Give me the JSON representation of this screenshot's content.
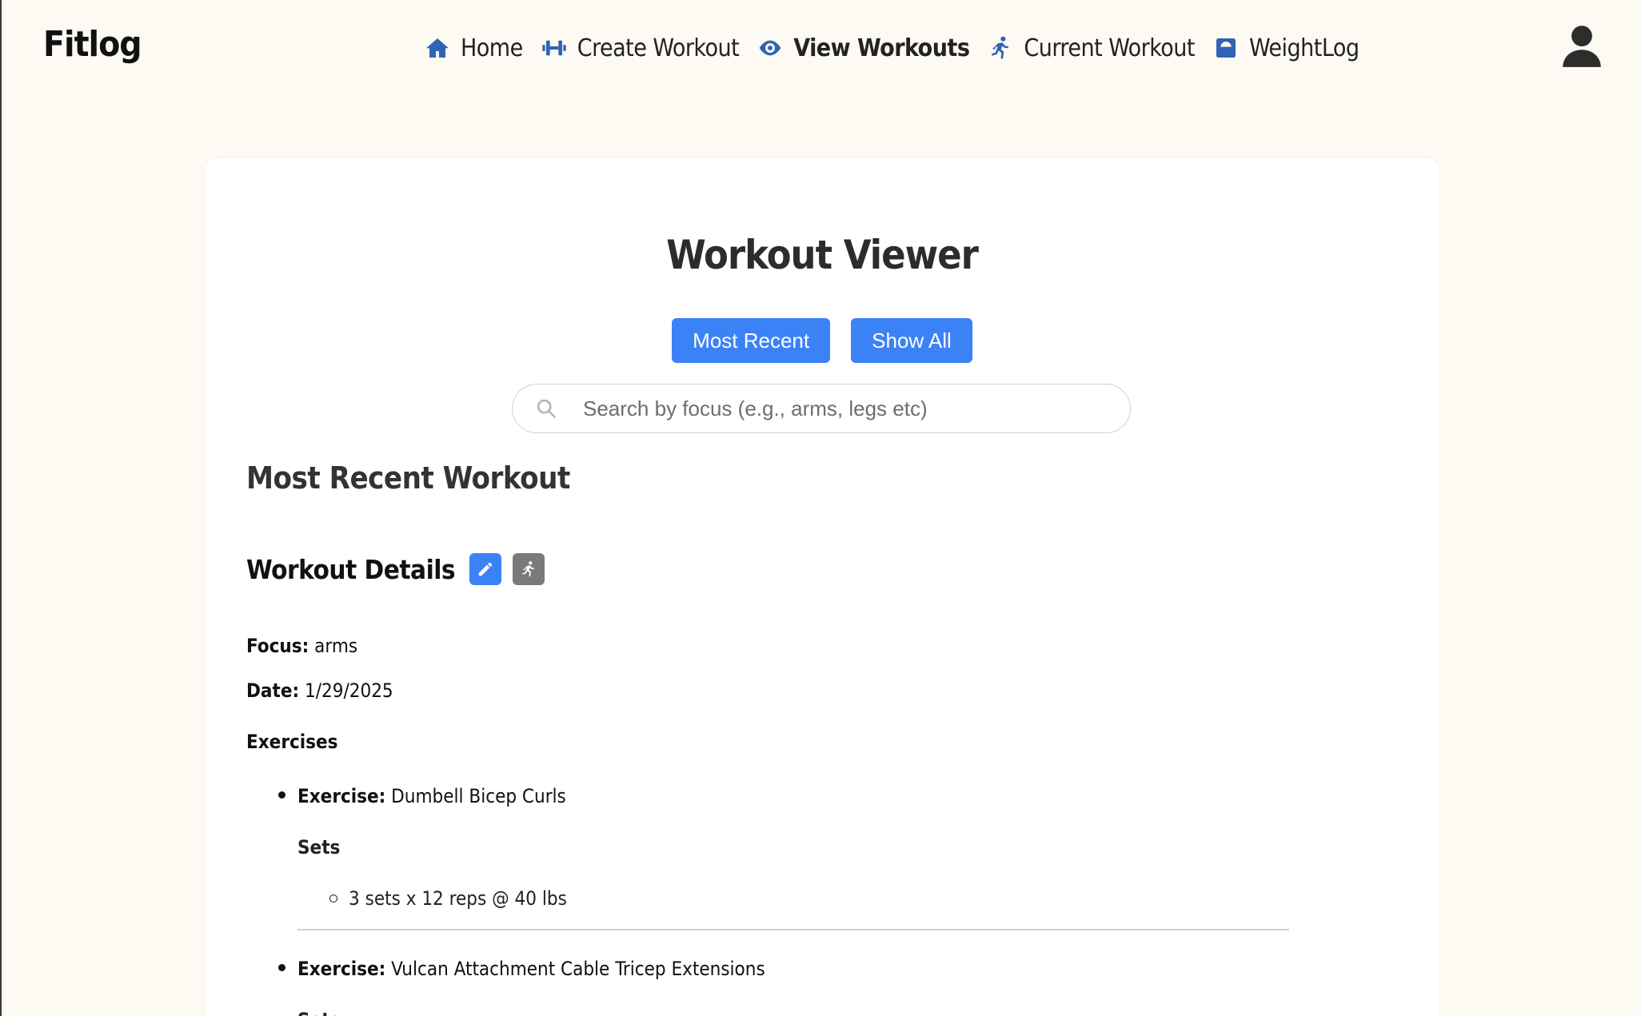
{
  "brand": "Fitlog",
  "nav": [
    {
      "label": "Home",
      "icon": "home-icon",
      "active": false
    },
    {
      "label": "Create Workout",
      "icon": "dumbbell-icon",
      "active": false
    },
    {
      "label": "View Workouts",
      "icon": "eye-icon",
      "active": true
    },
    {
      "label": "Current Workout",
      "icon": "running-icon",
      "active": false
    },
    {
      "label": "WeightLog",
      "icon": "scale-icon",
      "active": false
    }
  ],
  "page": {
    "title": "Workout Viewer",
    "buttons": {
      "most_recent": "Most Recent",
      "show_all": "Show All"
    },
    "search": {
      "placeholder": "Search by focus (e.g., arms, legs etc)",
      "value": ""
    },
    "section_title": "Most Recent Workout"
  },
  "workout": {
    "heading": "Workout Details",
    "focus_label": "Focus:",
    "focus": "arms",
    "date_label": "Date:",
    "date": "1/29/2025",
    "exercises_heading": "Exercises",
    "exercise_label": "Exercise:",
    "sets_label": "Sets",
    "exercises": [
      {
        "name": "Dumbell Bicep Curls",
        "sets": [
          "3 sets x 12 reps @ 40 lbs"
        ]
      },
      {
        "name": "Vulcan Attachment Cable Tricep Extensions",
        "sets": []
      }
    ]
  },
  "colors": {
    "accent": "#3b82f6",
    "nav_icon": "#2f63b5",
    "background": "#fcfaf2",
    "secondary_button": "#7a7a7a"
  }
}
